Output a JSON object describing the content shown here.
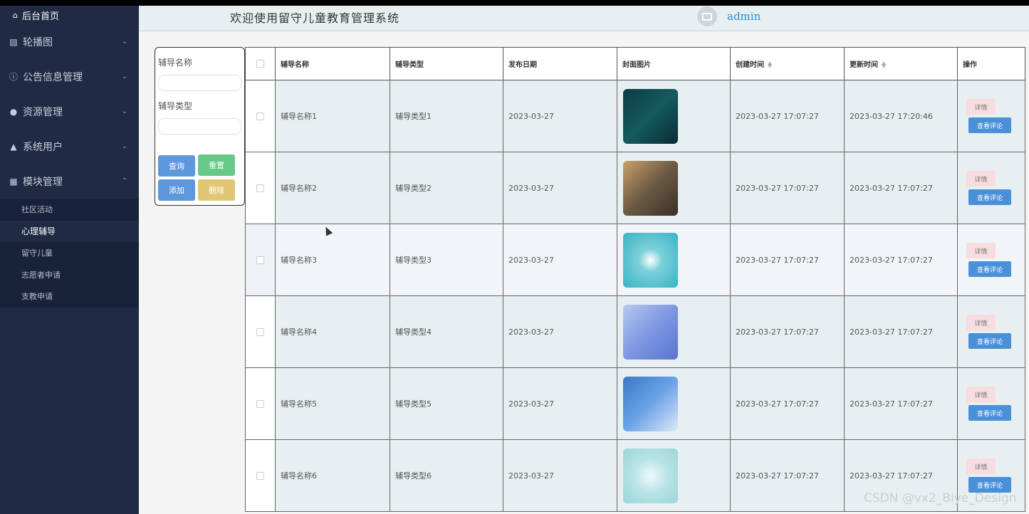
{
  "sidebar": {
    "home_label": "后台首页",
    "menus": [
      {
        "label": "轮播图",
        "icon": "image-icon"
      },
      {
        "label": "公告信息管理",
        "icon": "info-circle-icon"
      },
      {
        "label": "资源管理",
        "icon": "location-pin-icon"
      },
      {
        "label": "系统用户",
        "icon": "user-icon"
      },
      {
        "label": "模块管理",
        "icon": "grid-icon"
      }
    ],
    "sub_items": [
      {
        "label": "社区活动"
      },
      {
        "label": "心理辅导"
      },
      {
        "label": "留守儿童"
      },
      {
        "label": "志愿者申请"
      },
      {
        "label": "支教申请"
      }
    ]
  },
  "header": {
    "title": "欢迎使用留守儿童教育管理系统",
    "username": "admin"
  },
  "search": {
    "name_label": "辅导名称",
    "type_label": "辅导类型",
    "query_btn": "查询",
    "reset_btn": "重置",
    "add_btn": "添加",
    "delete_btn": "删除"
  },
  "table": {
    "headers": {
      "name": "辅导名称",
      "type": "辅导类型",
      "date": "发布日期",
      "image": "封面图片",
      "created": "创建时间",
      "updated": "更新时间",
      "ops": "操作"
    },
    "rows": [
      {
        "name": "辅导名称1",
        "type": "辅导类型1",
        "date": "2023-03-27",
        "created": "2023-03-27 17:07:27",
        "updated": "2023-03-27 17:20:46",
        "detail": "详情",
        "comment": "查看评论"
      },
      {
        "name": "辅导名称2",
        "type": "辅导类型2",
        "date": "2023-03-27",
        "created": "2023-03-27 17:07:27",
        "updated": "2023-03-27 17:07:27",
        "detail": "详情",
        "comment": "查看评论"
      },
      {
        "name": "辅导名称3",
        "type": "辅导类型3",
        "date": "2023-03-27",
        "created": "2023-03-27 17:07:27",
        "updated": "2023-03-27 17:07:27",
        "detail": "详情",
        "comment": "查看评论"
      },
      {
        "name": "辅导名称4",
        "type": "辅导类型4",
        "date": "2023-03-27",
        "created": "2023-03-27 17:07:27",
        "updated": "2023-03-27 17:07:27",
        "detail": "详情",
        "comment": "查看评论"
      },
      {
        "name": "辅导名称5",
        "type": "辅导类型5",
        "date": "2023-03-27",
        "created": "2023-03-27 17:07:27",
        "updated": "2023-03-27 17:07:27",
        "detail": "详情",
        "comment": "查看评论"
      },
      {
        "name": "辅导名称6",
        "type": "辅导类型6",
        "date": "2023-03-27",
        "created": "2023-03-27 17:07:27",
        "updated": "2023-03-27 17:07:27",
        "detail": "详情",
        "comment": "查看评论"
      }
    ]
  },
  "watermark": "CSDN @vx2_Biye_Design",
  "colors": {
    "sidebar_bg": "#1f2a44",
    "header_bg": "#e8eff1",
    "accent_blue": "#4a90d9",
    "success_green": "#67c987",
    "warning_yellow": "#e0c675",
    "detail_pink": "#f7dde0",
    "username_blue": "#1f8dd6"
  }
}
